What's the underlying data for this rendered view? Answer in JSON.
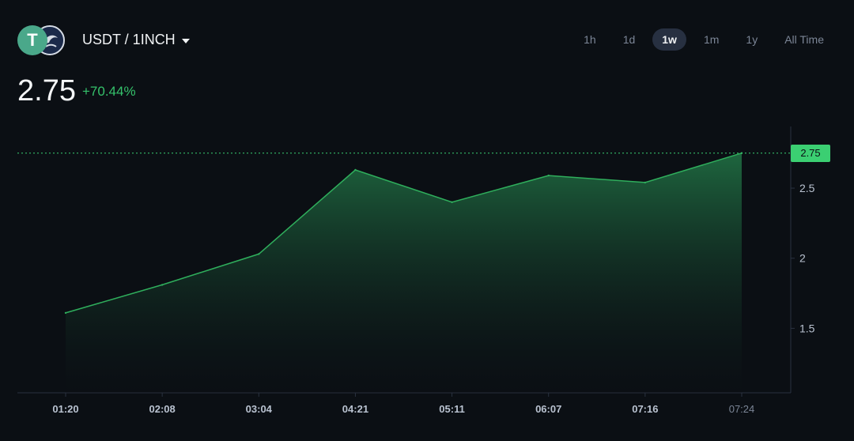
{
  "header": {
    "pair_label": "USDT / 1INCH",
    "base_icon": "tether-icon",
    "base_icon_glyph": "T",
    "quote_icon": "1inch-icon",
    "timeframes": [
      "1h",
      "1d",
      "1w",
      "1m",
      "1y",
      "All Time"
    ],
    "active_timeframe": "1w"
  },
  "price": {
    "value": "2.75",
    "change": "+70.44%"
  },
  "colors": {
    "up": "#35c26b",
    "line": "#2fae5c",
    "background": "#0b0f14"
  },
  "chart_data": {
    "type": "area",
    "x": [
      "01:20",
      "02:08",
      "03:04",
      "04:21",
      "05:11",
      "06:07",
      "07:16",
      "07:24"
    ],
    "values": [
      1.61,
      1.81,
      2.03,
      2.63,
      2.4,
      2.59,
      2.54,
      2.75
    ],
    "y_ticks": [
      "1.5",
      "2",
      "2.5"
    ],
    "y_tick_values": [
      1.5,
      2,
      2.5
    ],
    "ylim": [
      1.04,
      2.94
    ],
    "current_value_label": "2.75",
    "current_value": 2.75,
    "grid": false,
    "legend": "none"
  }
}
